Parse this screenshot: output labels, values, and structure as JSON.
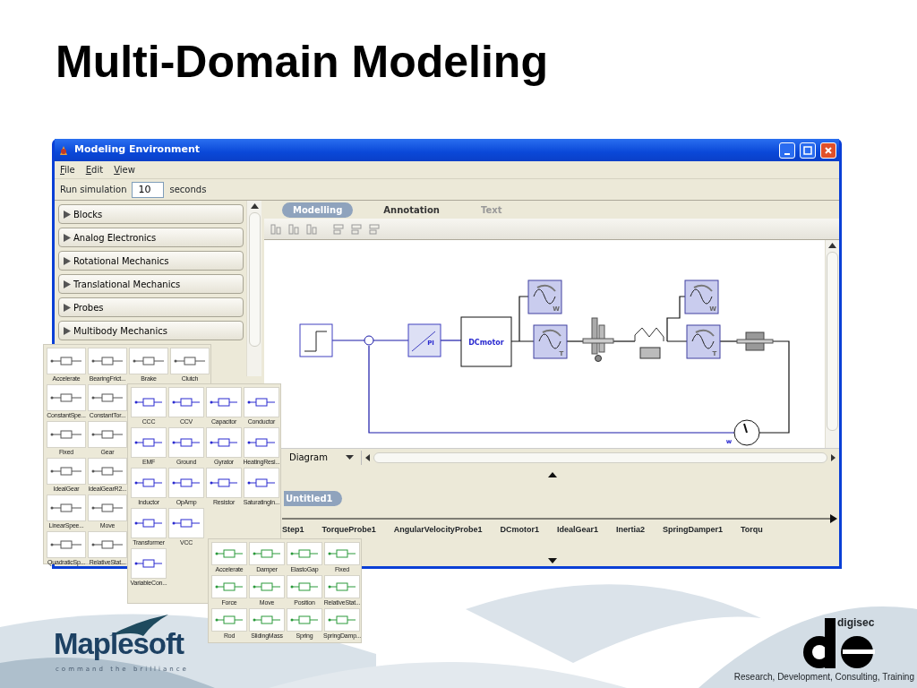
{
  "slide_title": "Multi-Domain Modeling",
  "window": {
    "title": "Modeling Environment"
  },
  "menu": [
    "File",
    "Edit",
    "View"
  ],
  "run_simulation": {
    "label": "Run simulation",
    "value": "10",
    "unit": "seconds"
  },
  "library_categories": [
    {
      "label": "Blocks",
      "expanded": false
    },
    {
      "label": "Analog Electronics",
      "expanded": false
    },
    {
      "label": "Rotational Mechanics",
      "expanded": false
    },
    {
      "label": "Translational Mechanics",
      "expanded": false
    },
    {
      "label": "Probes",
      "expanded": false
    },
    {
      "label": "Multibody Mechanics",
      "expanded": false
    }
  ],
  "tabs": [
    {
      "label": "Modelling",
      "selected": true,
      "disabled": false
    },
    {
      "label": "Annotation",
      "selected": false,
      "disabled": false
    },
    {
      "label": "Text",
      "selected": false,
      "disabled": true
    }
  ],
  "diagram": {
    "blocks": [
      {
        "kind": "step"
      },
      {
        "kind": "sum"
      },
      {
        "kind": "pi",
        "label": "PI"
      },
      {
        "kind": "motor",
        "label": "DCmotor"
      },
      {
        "kind": "probe",
        "label": "W"
      },
      {
        "kind": "probe",
        "label": "T"
      },
      {
        "kind": "gear"
      },
      {
        "kind": "spring-damper"
      },
      {
        "kind": "probe",
        "label": "W"
      },
      {
        "kind": "probe",
        "label": "T"
      },
      {
        "kind": "inertia"
      },
      {
        "kind": "sensor",
        "label": "w"
      }
    ]
  },
  "view_selector": {
    "value": "Diagram"
  },
  "simulation_panel": {
    "tab": "Untitled1",
    "timeline": [
      "Step1",
      "TorqueProbe1",
      "AngularVelocityProbe1",
      "DCmotor1",
      "IdealGear1",
      "Inertia2",
      "SpringDamper1",
      "Torqu"
    ]
  },
  "palettes": [
    {
      "kind": "rotational",
      "rows": [
        [
          "Accelerate",
          "BearingFrict...",
          "Brake",
          "Clutch"
        ],
        [
          "ConstantSpe...",
          "ConstantTor..."
        ],
        [
          "Fixed",
          "Gear"
        ],
        [
          "IdealGear",
          "IdealGearR2..."
        ],
        [
          "LinearSpee...",
          "Move"
        ],
        [
          "QuadraticSp...",
          "RelativeStat..."
        ]
      ]
    },
    {
      "kind": "electrical",
      "rows": [
        [
          "CCC",
          "CCV",
          "Capacitor",
          "Conductor"
        ],
        [
          "EMF",
          "Ground",
          "Gyrator",
          "HeatingResi..."
        ],
        [
          "Inductor",
          "OpAmp",
          "Resistor",
          "SaturatingIn..."
        ],
        [
          "Transformer",
          "VCC"
        ],
        [
          "VariableCon..."
        ]
      ]
    },
    {
      "kind": "translational",
      "rows": [
        [
          "Accelerate",
          "Damper",
          "ElastoGap",
          "Fixed"
        ],
        [
          "Force",
          "Move",
          "Position",
          "RelativeStat..."
        ],
        [
          "Rod",
          "SlidingMass",
          "Spring",
          "SpringDamp..."
        ]
      ]
    }
  ],
  "logos": {
    "maplesoft": {
      "name": "Maplesoft",
      "tagline": "command the brilliance"
    },
    "digisec": {
      "name": "digisec",
      "tagline": "Research, Development, Consulting, Training"
    }
  }
}
